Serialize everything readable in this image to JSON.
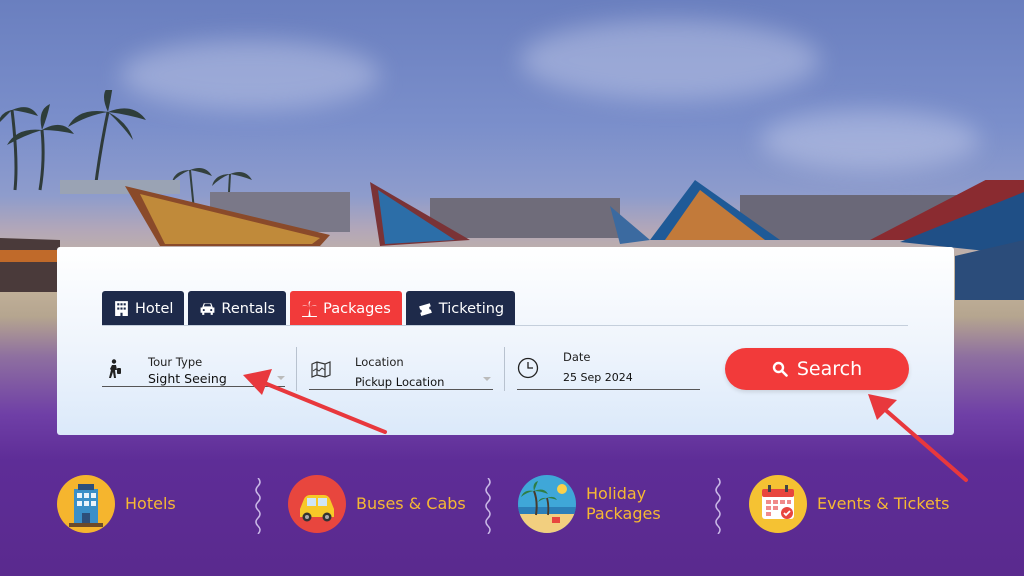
{
  "tabs": [
    {
      "label": "Hotel",
      "icon": "hotel-icon",
      "active": false
    },
    {
      "label": "Rentals",
      "icon": "car-icon",
      "active": false
    },
    {
      "label": "Packages",
      "icon": "palm-tree-icon",
      "active": true
    },
    {
      "label": "Ticketing",
      "icon": "ticket-icon",
      "active": false
    }
  ],
  "fields": {
    "tour_type": {
      "label": "Tour Type",
      "value": "Sight Seeing",
      "icon": "traveler-icon"
    },
    "location": {
      "label": "Location",
      "value": "Pickup Location",
      "icon": "map-icon"
    },
    "date": {
      "label": "Date",
      "value": "25 Sep 2024",
      "icon": "clock-icon"
    }
  },
  "search_button": {
    "label": "Search",
    "icon": "search-icon"
  },
  "categories": [
    {
      "label": "Hotels",
      "icon": "hotel-building-icon"
    },
    {
      "label": "Buses & Cabs",
      "icon": "taxi-icon"
    },
    {
      "label": "Holiday Packages",
      "line1": "Holiday",
      "line2": "Packages",
      "icon": "beach-icon"
    },
    {
      "label": "Events & Tickets",
      "icon": "calendar-icon"
    }
  ],
  "colors": {
    "accent": "#f23a3a",
    "tab_dark": "#1e2a4a",
    "category_text": "#f6b833",
    "bottom_bg": "#5a2a8e",
    "arrow": "#e8383d"
  }
}
